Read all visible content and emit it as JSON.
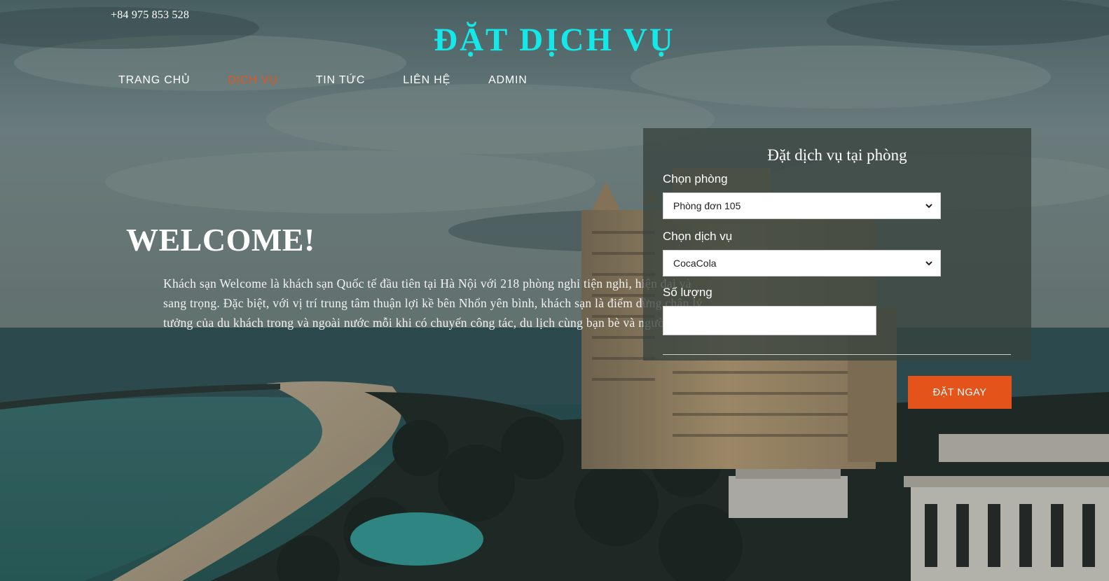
{
  "header": {
    "phone": "+84 975 853 528",
    "site_title": "ĐẶT DỊCH VỤ"
  },
  "nav": {
    "items": [
      {
        "label": "TRANG CHỦ",
        "active": false
      },
      {
        "label": "DỊCH VỤ",
        "active": true
      },
      {
        "label": "TIN TỨC",
        "active": false
      },
      {
        "label": "LIÊN HỆ",
        "active": false
      },
      {
        "label": "ADMIN",
        "active": false
      }
    ],
    "active_color": "#e4551c"
  },
  "welcome": {
    "title": "WELCOME!",
    "text": "Khách sạn Welcome là khách sạn Quốc tế đầu tiên tại Hà Nội với 218 phòng nghỉ tiện nghi, hiện đại và sang trọng. Đặc biệt, với vị trí trung tâm thuận lợi kề bên Nhổn yên bình, khách sạn là điểm dừng chân lý tưởng của du khách trong và ngoài nước mỗi khi có chuyến công tác, du lịch cùng bạn bè và người thân."
  },
  "booking": {
    "title": "Đặt dịch vụ tại phòng",
    "room_label": "Chọn phòng",
    "room_value": "Phòng đơn 105",
    "service_label": "Chọn dịch vụ",
    "service_value": "CocaCola",
    "quantity_label": "Số lượng",
    "quantity_value": "",
    "submit_label": "ĐẶT NGAY",
    "submit_color": "#e4531a"
  },
  "colors": {
    "title_cyan": "#15e8e8",
    "accent_orange": "#e4531a"
  }
}
